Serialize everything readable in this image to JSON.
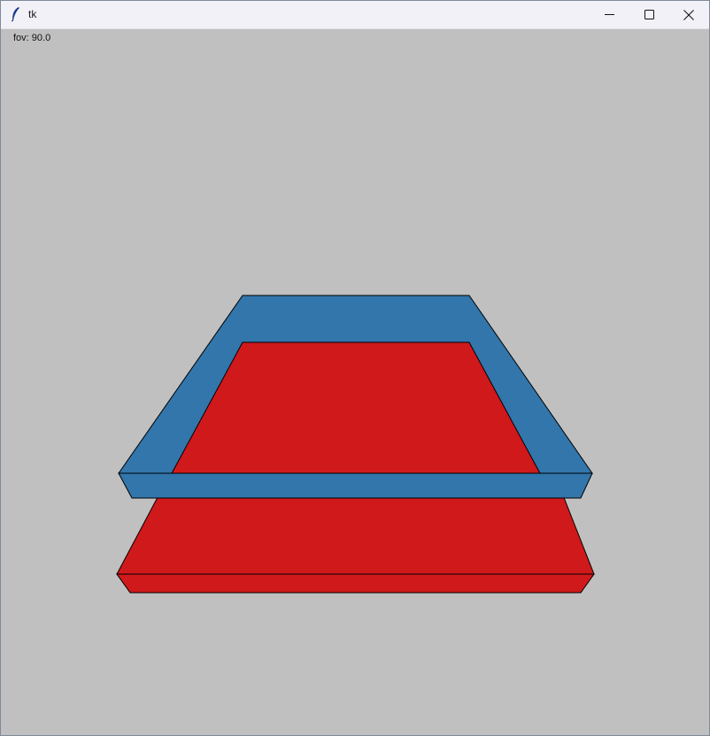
{
  "window": {
    "title": "tk",
    "app_icon": "feather-icon",
    "controls": {
      "minimize_icon": "minimize-icon",
      "maximize_icon": "maximize-icon",
      "close_icon": "close-icon"
    }
  },
  "canvas": {
    "background": "#c0c0c0",
    "fov_text": "fov: 90.0"
  },
  "colors": {
    "red_face": "#d0191b",
    "blue_face": "#3276ab",
    "edge": "#000000"
  }
}
